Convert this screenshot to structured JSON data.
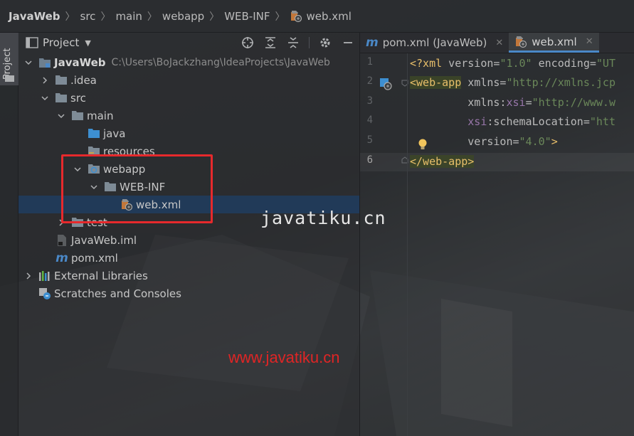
{
  "breadcrumb": {
    "items": [
      "JavaWeb",
      "src",
      "main",
      "webapp",
      "WEB-INF",
      "web.xml"
    ]
  },
  "tool_strip": {
    "project_tab_label": "Project"
  },
  "project_panel": {
    "title": "Project",
    "tools": [
      "target-icon",
      "expand-all-icon",
      "collapse-all-icon",
      "gear-icon",
      "minimize-icon"
    ],
    "tree": [
      {
        "label": "JavaWeb",
        "path": "C:\\Users\\BoJackzhang\\IdeaProjects\\JavaWeb",
        "depth": 0,
        "expanded": true,
        "icon": "module-folder-icon"
      },
      {
        "label": ".idea",
        "depth": 1,
        "expanded": false,
        "icon": "folder-icon"
      },
      {
        "label": "src",
        "depth": 1,
        "expanded": true,
        "icon": "folder-icon"
      },
      {
        "label": "main",
        "depth": 2,
        "expanded": true,
        "icon": "folder-icon"
      },
      {
        "label": "java",
        "depth": 3,
        "icon": "source-folder-icon"
      },
      {
        "label": "resources",
        "depth": 3,
        "icon": "resources-folder-icon"
      },
      {
        "label": "webapp",
        "depth": 3,
        "expanded": true,
        "icon": "web-folder-icon"
      },
      {
        "label": "WEB-INF",
        "depth": 4,
        "expanded": true,
        "icon": "folder-icon"
      },
      {
        "label": "web.xml",
        "depth": 5,
        "icon": "web-xml-icon",
        "selected": true
      },
      {
        "label": "test",
        "depth": 2,
        "expanded": false,
        "icon": "folder-icon"
      },
      {
        "label": "JavaWeb.iml",
        "depth": 1,
        "icon": "iml-file-icon"
      },
      {
        "label": "pom.xml",
        "depth": 1,
        "icon": "maven-icon"
      },
      {
        "label": "External Libraries",
        "depth": 0,
        "expanded": false,
        "icon": "libraries-icon"
      },
      {
        "label": "Scratches and Consoles",
        "depth": 0,
        "icon": "scratches-icon"
      }
    ]
  },
  "editor": {
    "tabs": [
      {
        "label": "pom.xml (JavaWeb)",
        "icon": "maven-icon",
        "active": false
      },
      {
        "label": "web.xml",
        "icon": "web-xml-icon",
        "active": true
      }
    ],
    "line_numbers": [
      "1",
      "2",
      "3",
      "4",
      "5",
      "6"
    ],
    "code": {
      "l1": {
        "pi_open": "<?xml",
        "attr1": " version=",
        "val1": "\"1.0\"",
        "attr2": " encoding=",
        "val2": "\"UT"
      },
      "l2": {
        "tag": "<web-app",
        "attr": " xmlns=",
        "val": "\"http://xmlns.jcp"
      },
      "l3": {
        "indent": "         ",
        "attr": "xmlns:",
        "ns": "xsi",
        "eq": "=",
        "val": "\"http://www.w"
      },
      "l4": {
        "indent": "         ",
        "ns": "xsi",
        "attr": ":schemaLocation=",
        "val": "\"htt"
      },
      "l5": {
        "indent": "         ",
        "attr": "version=",
        "val": "\"4.0\"",
        "close": ">"
      },
      "l6": {
        "tag": "</web-app>"
      }
    }
  },
  "watermarks": {
    "center": "javatiku.cn",
    "bottom": "www.javatiku.cn"
  },
  "colors": {
    "selection": "#213c5c",
    "accent_tab": "#4a88c7",
    "highlight_box": "#e6292c",
    "watermark_red": "#e02525"
  }
}
